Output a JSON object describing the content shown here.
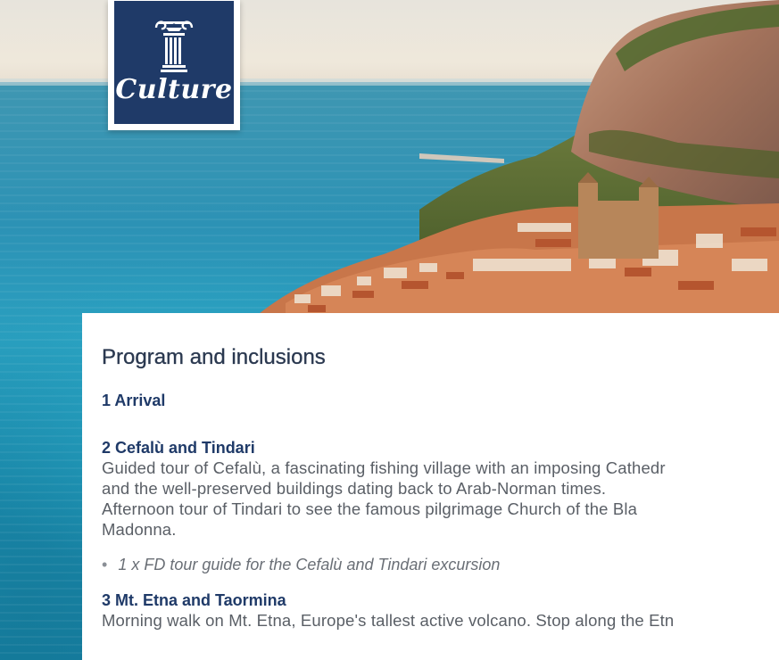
{
  "logo": {
    "brand_text": "Culture",
    "icon": "ionic-column-icon",
    "colors": {
      "navy": "#1f3a68",
      "frame": "#ffffff"
    }
  },
  "program": {
    "heading": "Program and inclusions",
    "days": [
      {
        "title": "1 Arrival"
      },
      {
        "title": "2 Cefalù and Tindari",
        "lines": [
          "Guided tour of Cefalù, a fascinating fishing village with an imposing Cathedr",
          "and the well-preserved buildings dating back to Arab-Norman times.",
          "Afternoon tour of Tindari to see the famous pilgrimage Church of the Bla",
          "Madonna."
        ],
        "inclusion": "1 x FD tour guide for the Cefalù and Tindari excursion"
      },
      {
        "title": "3 Mt. Etna and Taormina",
        "lines": [
          "Morning walk on Mt. Etna, Europe's tallest active volcano. Stop along the Etn"
        ]
      }
    ],
    "colors": {
      "heading": "#2b3950",
      "day_title": "#1f3a68",
      "body": "#5a5f66"
    }
  },
  "scene": {
    "description_icons": [
      "sea",
      "cliff",
      "town",
      "cathedral"
    ]
  }
}
